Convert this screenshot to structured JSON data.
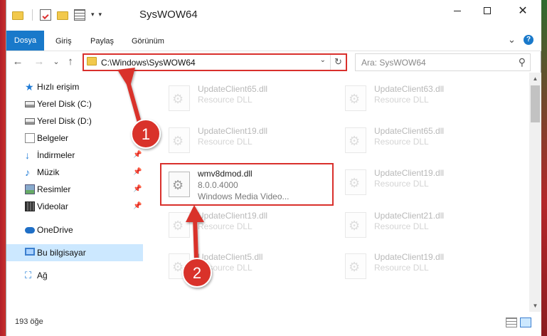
{
  "window": {
    "title": "SysWOW64",
    "quick_access_arrow": "▾",
    "controls": {
      "minimize": "",
      "maximize": "",
      "close": "✕"
    }
  },
  "ribbon": {
    "tabs": [
      "Dosya",
      "Giriş",
      "Paylaş",
      "Görünüm"
    ],
    "expand_icon": "⌄",
    "help_icon": "?"
  },
  "address": {
    "path": "C:\\Windows\\SysWOW64",
    "dropdown": "⌄",
    "refresh": "↻"
  },
  "search": {
    "placeholder": "Ara: SysWOW64",
    "icon": "⚲"
  },
  "nav": {
    "back": "←",
    "forward": "→",
    "history": "⌄",
    "up": "↑"
  },
  "sidebar": {
    "items": [
      {
        "label": "Hızlı erişim",
        "icon": "star-icon"
      },
      {
        "label": "Yerel Disk (C:)",
        "icon": "drive-icon"
      },
      {
        "label": "Yerel Disk (D:)",
        "icon": "drive-icon"
      },
      {
        "label": "Belgeler",
        "icon": "documents-icon",
        "pinned": true
      },
      {
        "label": "İndirmeler",
        "icon": "download-icon",
        "pinned": true
      },
      {
        "label": "Müzik",
        "icon": "music-icon",
        "pinned": true
      },
      {
        "label": "Resimler",
        "icon": "pictures-icon",
        "pinned": true
      },
      {
        "label": "Videolar",
        "icon": "video-icon",
        "pinned": true
      },
      {
        "label": "OneDrive",
        "icon": "cloud-icon"
      },
      {
        "label": "Bu bilgisayar",
        "icon": "computer-icon",
        "selected": true
      },
      {
        "label": "Ağ",
        "icon": "network-icon"
      }
    ],
    "pin_glyph": "📌"
  },
  "files": [
    {
      "name": "UpdateClient65.dll",
      "desc": "Resource DLL"
    },
    {
      "name": "UpdateClient63.dll",
      "desc": "Resource DLL"
    },
    {
      "name": "UpdateClient19.dll",
      "desc": "Resource DLL"
    },
    {
      "name": "UpdateClient65.dll",
      "desc": "Resource DLL"
    },
    {
      "name": "wmv8dmod.dll",
      "version": "8.0.0.4000",
      "desc": "Windows Media Video...",
      "highlighted": true
    },
    {
      "name": "UpdateClient19.dll",
      "desc": "Resource DLL"
    },
    {
      "name": "UpdateClient19.dll",
      "desc": "Resource DLL"
    },
    {
      "name": "UpdateClient21.dll",
      "desc": "Resource DLL"
    },
    {
      "name": "UpdateClient5.dll",
      "desc": "Resource DLL"
    },
    {
      "name": "UpdateClient19.dll",
      "desc": "Resource DLL"
    }
  ],
  "status": {
    "item_count": "193 öğe"
  },
  "annotations": {
    "step1": "1",
    "step2": "2",
    "color": "#d9302c"
  },
  "scroll": {
    "up": "▲",
    "down": "▼"
  }
}
